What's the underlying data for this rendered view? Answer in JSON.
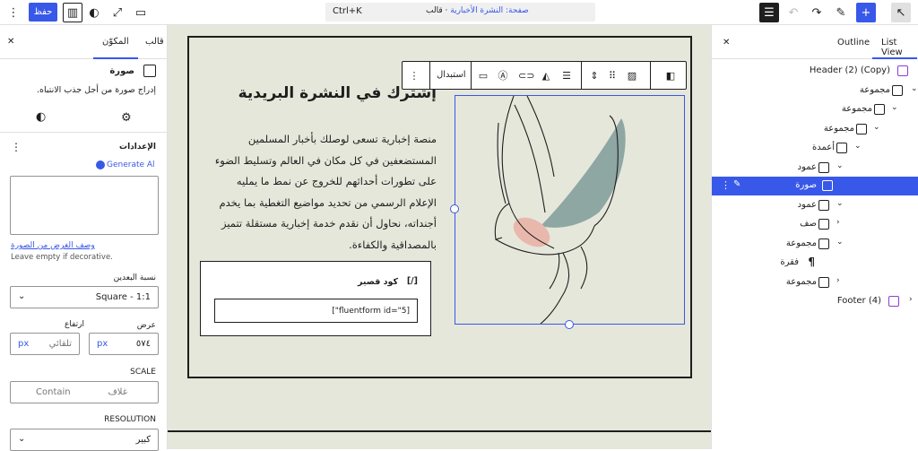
{
  "topbar": {
    "save_label": "حفظ",
    "command_shortcut": "Ctrl+K",
    "doc_title_prefix": "صفحة: النشرة الأخبارية",
    "doc_title_suffix": "· قالب"
  },
  "left_sidebar": {
    "tab_template": "قالب",
    "tab_block": "المكوّن",
    "block_title": "صورة",
    "block_description": "إدراج صورة من أجل جذب الانتباه.",
    "settings_label": "الإعدادات",
    "generate_label": "Generate Al",
    "alt_link": "وصف الغرض من الصورة",
    "alt_hint": "Leave empty if decorative.",
    "aspect_label": "نسبة البعدين",
    "aspect_value": "Square - 1:1",
    "width_label": "عرض",
    "height_label": "ارتفاع",
    "width_value": "٥٧٤",
    "width_unit": "px",
    "height_value": "تلقائي",
    "height_unit": "px",
    "scale_label": "SCALE",
    "scale_left": "Contain",
    "scale_right": "غلاف",
    "resolution_label": "RESOLUTION",
    "resolution_value": "كبير"
  },
  "canvas": {
    "heading": "إشترك في النشرة البريدية",
    "paragraph": "منصة إخبارية تسعى لوصلك بأخبار المسلمين المستضعفين في كل مكان في العالم وتسليط الضوء على تطورات أحداثهم للخروج عن نمط ما يمليه الإعلام الرسمي من تحديد مواضيع التغطية بما يخدم أجنداته، نحاول أن نقدم خدمة إخبارية مستقلة تتميز بالمصداقية والكفاءة.",
    "shortcode_title": "كود قصير",
    "shortcode_icon": "[/]",
    "shortcode_value": "[\"fluentform id=\"5]",
    "toolbar_replace": "استبدال"
  },
  "right_sidebar": {
    "tab_list": "List View",
    "tab_outline": "Outline",
    "items": [
      {
        "label": "Header (2) (Copy)"
      },
      {
        "label": "مجموعة"
      },
      {
        "label": "مجموعة"
      },
      {
        "label": "مجموعة"
      },
      {
        "label": "أعمدة"
      },
      {
        "label": "عمود"
      },
      {
        "label": "صورة"
      },
      {
        "label": "عمود"
      },
      {
        "label": "صف"
      },
      {
        "label": "مجموعة"
      },
      {
        "label": "فقرة"
      },
      {
        "label": "مجموعة"
      },
      {
        "label": "Footer (4)"
      }
    ]
  },
  "colors": {
    "accent": "#3858e9",
    "canvas_bg": "#e6e7db",
    "bird_teal": "#8fa7a3",
    "bird_pink": "#e9b8ad",
    "header_icon": "#8a3fd1"
  }
}
